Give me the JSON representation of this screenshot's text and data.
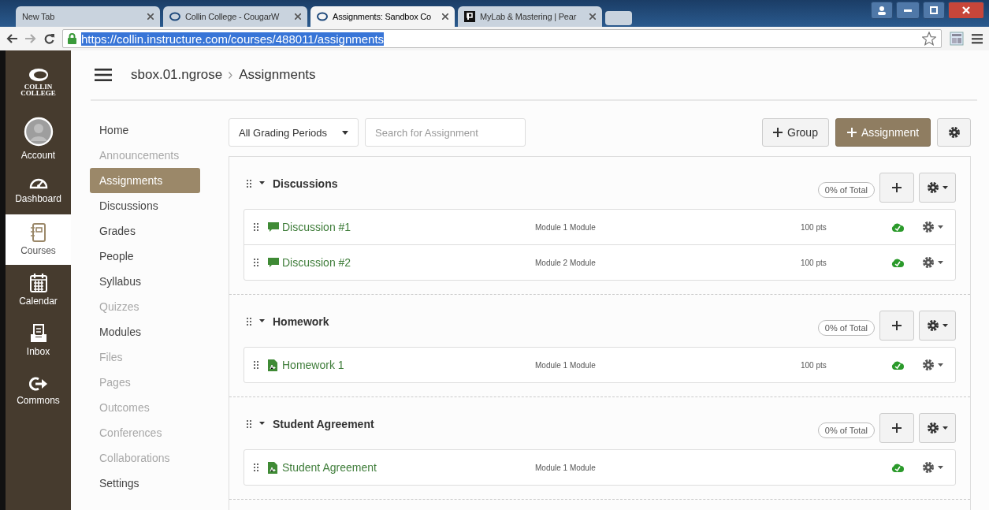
{
  "browser": {
    "tabs": [
      {
        "title": "New Tab",
        "kind": "blank",
        "selected": false
      },
      {
        "title": "Collin College - CougarW",
        "kind": "collin",
        "selected": false
      },
      {
        "title": "Assignments: Sandbox Co",
        "kind": "collin",
        "selected": true
      },
      {
        "title": "MyLab & Mastering | Pear",
        "kind": "pearson",
        "selected": false
      }
    ],
    "url": "https://collin.instructure.com/courses/488011/assignments",
    "url_selected": true
  },
  "global_nav": {
    "logo": [
      "COLLIN",
      "COLLEGE"
    ],
    "items": [
      {
        "label": "Account",
        "kind": "account",
        "selected": false
      },
      {
        "label": "Dashboard",
        "kind": "dashboard",
        "selected": false
      },
      {
        "label": "Courses",
        "kind": "courses",
        "selected": true
      },
      {
        "label": "Calendar",
        "kind": "calendar",
        "selected": false
      },
      {
        "label": "Inbox",
        "kind": "inbox",
        "selected": false
      },
      {
        "label": "Commons",
        "kind": "commons",
        "selected": false
      }
    ]
  },
  "breadcrumb": [
    "sbox.01.ngrose",
    "Assignments"
  ],
  "course_nav": [
    {
      "label": "Home",
      "selected": false,
      "disabled": false
    },
    {
      "label": "Announcements",
      "selected": false,
      "disabled": true
    },
    {
      "label": "Assignments",
      "selected": true,
      "disabled": false
    },
    {
      "label": "Discussions",
      "selected": false,
      "disabled": false
    },
    {
      "label": "Grades",
      "selected": false,
      "disabled": false
    },
    {
      "label": "People",
      "selected": false,
      "disabled": false
    },
    {
      "label": "Syllabus",
      "selected": false,
      "disabled": false
    },
    {
      "label": "Quizzes",
      "selected": false,
      "disabled": true
    },
    {
      "label": "Modules",
      "selected": false,
      "disabled": false
    },
    {
      "label": "Files",
      "selected": false,
      "disabled": true
    },
    {
      "label": "Pages",
      "selected": false,
      "disabled": true
    },
    {
      "label": "Outcomes",
      "selected": false,
      "disabled": true
    },
    {
      "label": "Conferences",
      "selected": false,
      "disabled": true
    },
    {
      "label": "Collaborations",
      "selected": false,
      "disabled": true
    },
    {
      "label": "Settings",
      "selected": false,
      "disabled": false
    }
  ],
  "toolbar": {
    "grading_period": "All Grading Periods",
    "search": {
      "placeholder": "Search for Assignment"
    },
    "add_group": "Group",
    "add_assignment": "Assignment"
  },
  "groups": [
    {
      "name": "Discussions",
      "expanded": true,
      "weight": "0% of Total",
      "items": [
        {
          "kind": "discussion",
          "title": "Discussion #1",
          "module": "Module 1 Module",
          "points": "100 pts",
          "published": true
        },
        {
          "kind": "discussion",
          "title": "Discussion #2",
          "module": "Module 2 Module",
          "points": "100 pts",
          "published": true
        }
      ]
    },
    {
      "name": "Homework",
      "expanded": true,
      "weight": "0% of Total",
      "items": [
        {
          "kind": "assignment",
          "title": "Homework 1",
          "module": "Module 1 Module",
          "points": "100 pts",
          "published": true
        }
      ]
    },
    {
      "name": "Student Agreement",
      "expanded": true,
      "weight": "0% of Total",
      "items": [
        {
          "kind": "assignment",
          "title": "Student Agreement",
          "module": "Module 1 Module",
          "published": true
        }
      ]
    }
  ]
}
